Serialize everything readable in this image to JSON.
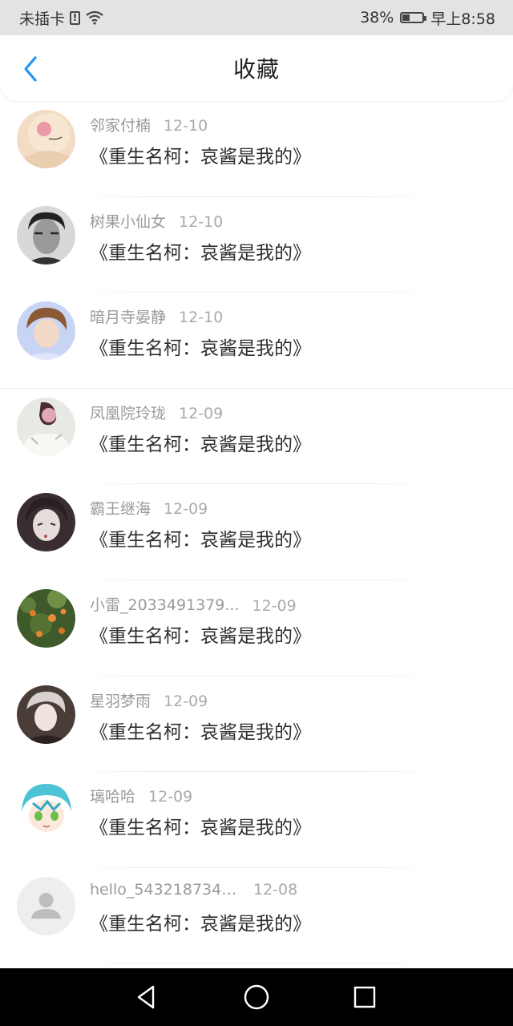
{
  "status_bar": {
    "carrier": "未插卡",
    "battery_percent": "38%",
    "battery_level": 0.38,
    "time": "早上8:58",
    "icons": [
      "sim-alert-icon",
      "wifi-icon",
      "battery-charging-icon"
    ]
  },
  "header": {
    "title": "收藏",
    "back_icon": "chevron-left-icon",
    "accent_color": "#2196f3"
  },
  "items": [
    {
      "user": "邻家付楠",
      "date": "12-10",
      "title": "《重生名柯：哀酱是我的》",
      "avatar_icon": "user-avatar"
    },
    {
      "user": "树果小仙女",
      "date": "12-10",
      "title": "《重生名柯：哀酱是我的》",
      "avatar_icon": "user-avatar"
    },
    {
      "user": "暗月寺晏静",
      "date": "12-10",
      "title": "《重生名柯：哀酱是我的》",
      "avatar_icon": "user-avatar"
    },
    {
      "user": "凤凰院玲珑",
      "date": "12-09",
      "title": "《重生名柯：哀酱是我的》",
      "avatar_icon": "user-avatar"
    },
    {
      "user": "霸王继海",
      "date": "12-09",
      "title": "《重生名柯：哀酱是我的》",
      "avatar_icon": "user-avatar"
    },
    {
      "user": "小雷_2033491379...",
      "date": "12-09",
      "title": "《重生名柯：哀酱是我的》",
      "avatar_icon": "user-avatar"
    },
    {
      "user": "星羽梦雨",
      "date": "12-09",
      "title": "《重生名柯：哀酱是我的》",
      "avatar_icon": "user-avatar"
    },
    {
      "user": "璃哈哈",
      "date": "12-09",
      "title": "《重生名柯：哀酱是我的》",
      "avatar_icon": "user-avatar"
    },
    {
      "user": "hello_5432187347...",
      "date": "12-08",
      "title": "《重生名柯：哀酱是我的》",
      "avatar_icon": "default-avatar-icon"
    }
  ],
  "nav_bar": {
    "icons": [
      "nav-back-icon",
      "nav-home-icon",
      "nav-recents-icon"
    ]
  }
}
